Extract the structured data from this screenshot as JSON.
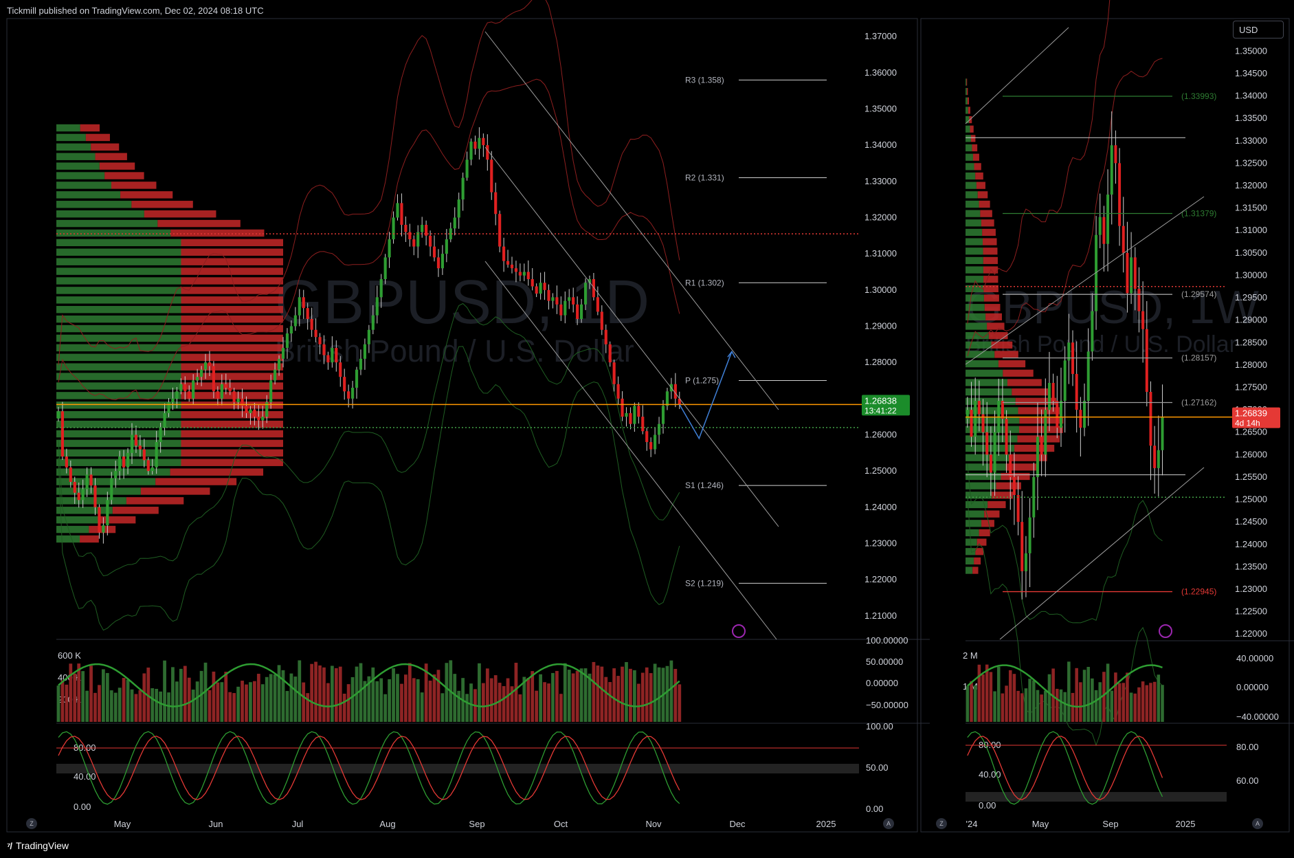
{
  "header": {
    "published": "Tickmill published on TradingView.com, Dec 02, 2024 08:18 UTC"
  },
  "footer": {
    "brand": "TradingView"
  },
  "controls": {
    "currency": "USD",
    "nav_left": "Z",
    "nav_right": "A"
  },
  "colors": {
    "up": "#2e7d32",
    "down": "#c62828",
    "bg": "#000000",
    "axis_text": "#d1d4dc",
    "price_line": "#ff9800",
    "volume_ma": "#2e7d32",
    "osc_red": "#e53935"
  },
  "chart_data": [
    {
      "type": "candlestick",
      "panel": "daily",
      "watermark_symbol": "GBPUSD, 1D",
      "watermark_name": "British Pound / U.S. Dollar",
      "y_ticks": [
        "1.37000",
        "1.36000",
        "1.35000",
        "1.34000",
        "1.33000",
        "1.32000",
        "1.31000",
        "1.30000",
        "1.29000",
        "1.28000",
        "1.27000",
        "1.26000",
        "1.25000",
        "1.24000",
        "1.23000",
        "1.22000",
        "1.21000"
      ],
      "ylim": [
        1.2035,
        1.3725
      ],
      "x_ticks": [
        "May",
        "Jun",
        "Jul",
        "Aug",
        "Sep",
        "Oct",
        "Nov",
        "Dec",
        "2025"
      ],
      "current_price": "1.26838",
      "countdown": "13:41:22",
      "pivots": [
        {
          "label": "R3 (1.358)",
          "value": 1.358
        },
        {
          "label": "R2 (1.331)",
          "value": 1.331
        },
        {
          "label": "R1 (1.302)",
          "value": 1.302
        },
        {
          "label": "P (1.275)",
          "value": 1.275
        },
        {
          "label": "S1 (1.246)",
          "value": 1.246
        },
        {
          "label": "S2 (1.219)",
          "value": 1.219
        }
      ],
      "level_red_dotted": 1.3155,
      "level_green_dotted": 1.262,
      "closes": [
        1.2665,
        1.254,
        1.251,
        1.247,
        1.244,
        1.242,
        1.245,
        1.249,
        1.246,
        1.24,
        1.233,
        1.235,
        1.242,
        1.248,
        1.25,
        1.254,
        1.251,
        1.255,
        1.26,
        1.257,
        1.256,
        1.253,
        1.25,
        1.251,
        1.258,
        1.262,
        1.266,
        1.269,
        1.27,
        1.272,
        1.274,
        1.272,
        1.27,
        1.275,
        1.276,
        1.278,
        1.28,
        1.279,
        1.272,
        1.27,
        1.274,
        1.273,
        1.272,
        1.269,
        1.27,
        1.268,
        1.266,
        1.267,
        1.265,
        1.264,
        1.265,
        1.269,
        1.275,
        1.278,
        1.281,
        1.284,
        1.288,
        1.29,
        1.293,
        1.298,
        1.295,
        1.292,
        1.289,
        1.287,
        1.285,
        1.282,
        1.28,
        1.284,
        1.28,
        1.276,
        1.272,
        1.27,
        1.273,
        1.278,
        1.281,
        1.285,
        1.289,
        1.293,
        1.298,
        1.303,
        1.309,
        1.314,
        1.32,
        1.324,
        1.318,
        1.316,
        1.314,
        1.312,
        1.316,
        1.318,
        1.315,
        1.312,
        1.309,
        1.306,
        1.31,
        1.314,
        1.317,
        1.32,
        1.325,
        1.331,
        1.336,
        1.341,
        1.339,
        1.342,
        1.34,
        1.336,
        1.327,
        1.321,
        1.312,
        1.308,
        1.307,
        1.306,
        1.305,
        1.304,
        1.305,
        1.303,
        1.301,
        1.299,
        1.302,
        1.3,
        1.297,
        1.298,
        1.296,
        1.293,
        1.297,
        1.298,
        1.296,
        1.292,
        1.296,
        1.302,
        1.303,
        1.298,
        1.294,
        1.289,
        1.285,
        1.28,
        1.274,
        1.27,
        1.265,
        1.266,
        1.263,
        1.268,
        1.265,
        1.261,
        1.258,
        1.256,
        1.26,
        1.263,
        1.268,
        1.272,
        1.274,
        1.27,
        1.2684
      ],
      "forecast_path": [
        [
          1.2684,
          0
        ],
        [
          1.259,
          3
        ],
        [
          1.283,
          8
        ]
      ],
      "volume_ticks": [
        "600 K",
        "400 K",
        "200 K"
      ],
      "volume_right_ticks": [
        "100.00000",
        "50.00000",
        "0.00000",
        "−50.00000"
      ],
      "stoch_ticks": [
        "80.00",
        "40.00",
        "0.00"
      ],
      "stoch_right_ticks": [
        "100.00",
        "50.00",
        "0.00"
      ]
    },
    {
      "type": "candlestick",
      "panel": "weekly",
      "watermark_symbol": "GBPUSD, 1W",
      "watermark_name": "British Pound / U.S. Dollar",
      "y_ticks": [
        "1.35000",
        "1.34500",
        "1.34000",
        "1.33500",
        "1.33000",
        "1.32500",
        "1.32000",
        "1.31500",
        "1.31000",
        "1.30500",
        "1.30000",
        "1.29500",
        "1.29000",
        "1.28500",
        "1.28000",
        "1.27500",
        "1.27000",
        "1.26500",
        "1.26000",
        "1.25500",
        "1.25000",
        "1.24500",
        "1.24000",
        "1.23500",
        "1.23000",
        "1.22500",
        "1.22000"
      ],
      "ylim": [
        1.2185,
        1.3525
      ],
      "x_ticks": [
        "'24",
        "May",
        "Sep",
        "2025"
      ],
      "current_price": "1.26839",
      "countdown": "4d 14h",
      "levels": [
        {
          "label": "(1.33993)",
          "value": 1.33993,
          "color": "#2e7d32"
        },
        {
          "label": "(1.31379)",
          "value": 1.31379,
          "color": "#2e7d32"
        },
        {
          "label": "(1.29574)",
          "value": 1.29574,
          "color": "#9e9e9e"
        },
        {
          "label": "(1.28157)",
          "value": 1.28157,
          "color": "#9e9e9e"
        },
        {
          "label": "(1.27162)",
          "value": 1.27162,
          "color": "#9e9e9e"
        },
        {
          "label": "(1.22945)",
          "value": 1.22945,
          "color": "#e53935"
        }
      ],
      "extra_lines": [
        1.3307,
        1.2555
      ],
      "level_red_dotted": 1.2975,
      "level_green_dotted": 1.2505,
      "closes": [
        1.27,
        1.264,
        1.272,
        1.269,
        1.265,
        1.26,
        1.256,
        1.265,
        1.272,
        1.268,
        1.26,
        1.255,
        1.251,
        1.245,
        1.234,
        1.238,
        1.246,
        1.255,
        1.264,
        1.26,
        1.27,
        1.276,
        1.272,
        1.266,
        1.272,
        1.281,
        1.285,
        1.278,
        1.27,
        1.266,
        1.272,
        1.283,
        1.292,
        1.309,
        1.313,
        1.307,
        1.318,
        1.329,
        1.325,
        1.311,
        1.305,
        1.296,
        1.304,
        1.297,
        1.292,
        1.288,
        1.274,
        1.262,
        1.257,
        1.261,
        1.2684
      ],
      "volume_ticks": [
        "2 M",
        "1 M"
      ],
      "volume_right_ticks": [
        "40.00000",
        "0.00000",
        "−40.00000"
      ],
      "stoch_ticks": [
        "80.00",
        "40.00",
        "0.00"
      ],
      "stoch_right_ticks": [
        "80.00",
        "60.00"
      ]
    }
  ]
}
